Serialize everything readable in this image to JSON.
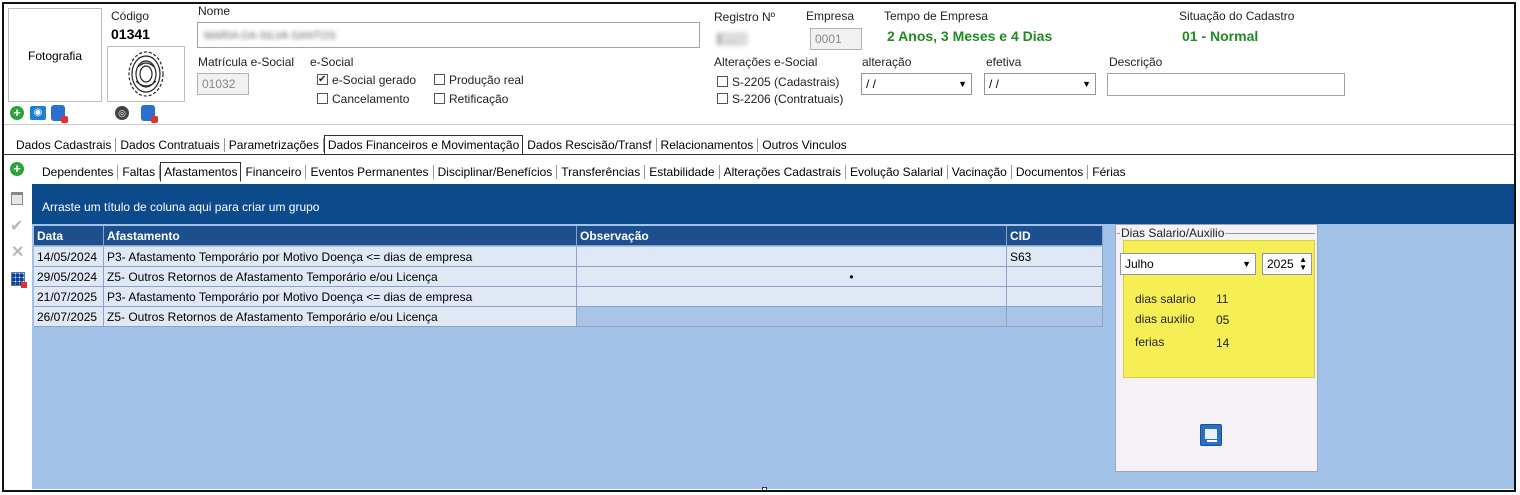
{
  "header": {
    "photo_label": "Fotografia",
    "codigo_label": "Código",
    "codigo_value": "01341",
    "nome_label": "Nome",
    "nome_value": "MARIA DA SILVA SANTOS",
    "registro_label": "Registro Nº",
    "registro_value": "1 ...",
    "empresa_label": "Empresa",
    "empresa_value": "0001",
    "tempo_label": "Tempo de Empresa",
    "tempo_value": "2 Anos, 3 Meses  e 4 Dias",
    "situacao_label": "Situação do Cadastro",
    "situacao_value": "01 - Normal",
    "matricula_label": "Matrícula e-Social",
    "matricula_value": "01032",
    "esocial_label": "e-Social",
    "esocial_gerado": "e-Social gerado",
    "producao_real": "Produção real",
    "cancelamento": "Cancelamento",
    "retificacao": "Retificação",
    "alteracoes_label": "Alterações e-Social",
    "s2205": "S-2205 (Cadastrais)",
    "s2206": "S-2206 (Contratuais)",
    "alteracao_label": "alteração",
    "alteracao_value": "/ /",
    "efetiva_label": "efetiva",
    "efetiva_value": "/ /",
    "descricao_label": "Descrição",
    "descricao_value": ""
  },
  "main_tabs": [
    "Dados Cadastrais",
    "Dados Contratuais",
    "Parametrizações",
    "Dados Financeiros e Movimentação",
    "Dados Rescisão/Transf",
    "Relacionamentos",
    "Outros Vinculos"
  ],
  "sub_tabs": [
    "Dependentes",
    "Faltas",
    "Afastamentos",
    "Financeiro",
    "Eventos Permanentes",
    "Disciplinar/Benefícios",
    "Transferências",
    "Estabilidade",
    "Alterações Cadastrais",
    "Evolução Salarial",
    "Vacinação",
    "Documentos",
    "Férias"
  ],
  "grid": {
    "group_hint": "Arraste um título de coluna aqui para criar um grupo",
    "columns": [
      "Data",
      "Afastamento",
      "Observação",
      "CID"
    ],
    "rows": [
      {
        "data": "14/05/2024",
        "afastamento": "P3- Afastamento Temporário por Motivo Doença <= dias de empresa",
        "obs": "",
        "cid": "S63"
      },
      {
        "data": "29/05/2024",
        "afastamento": "Z5- Outros Retornos de Afastamento Temporário e/ou Licença",
        "obs": "•",
        "cid": ""
      },
      {
        "data": "21/07/2025",
        "afastamento": "P3- Afastamento Temporário por Motivo Doença <= dias de empresa",
        "obs": "",
        "cid": ""
      },
      {
        "data": "26/07/2025",
        "afastamento": "Z5- Outros Retornos de Afastamento Temporário e/ou Licença",
        "obs": "",
        "cid": ""
      }
    ]
  },
  "panel": {
    "title": "Dias Salario/Auxilio",
    "month": "Julho",
    "year": "2025",
    "dias_salario_label": "dias salario",
    "dias_salario_value": "11",
    "dias_auxilio_label": "dias auxilio",
    "dias_auxilio_value": "05",
    "ferias_label": "ferias",
    "ferias_value": "14"
  }
}
